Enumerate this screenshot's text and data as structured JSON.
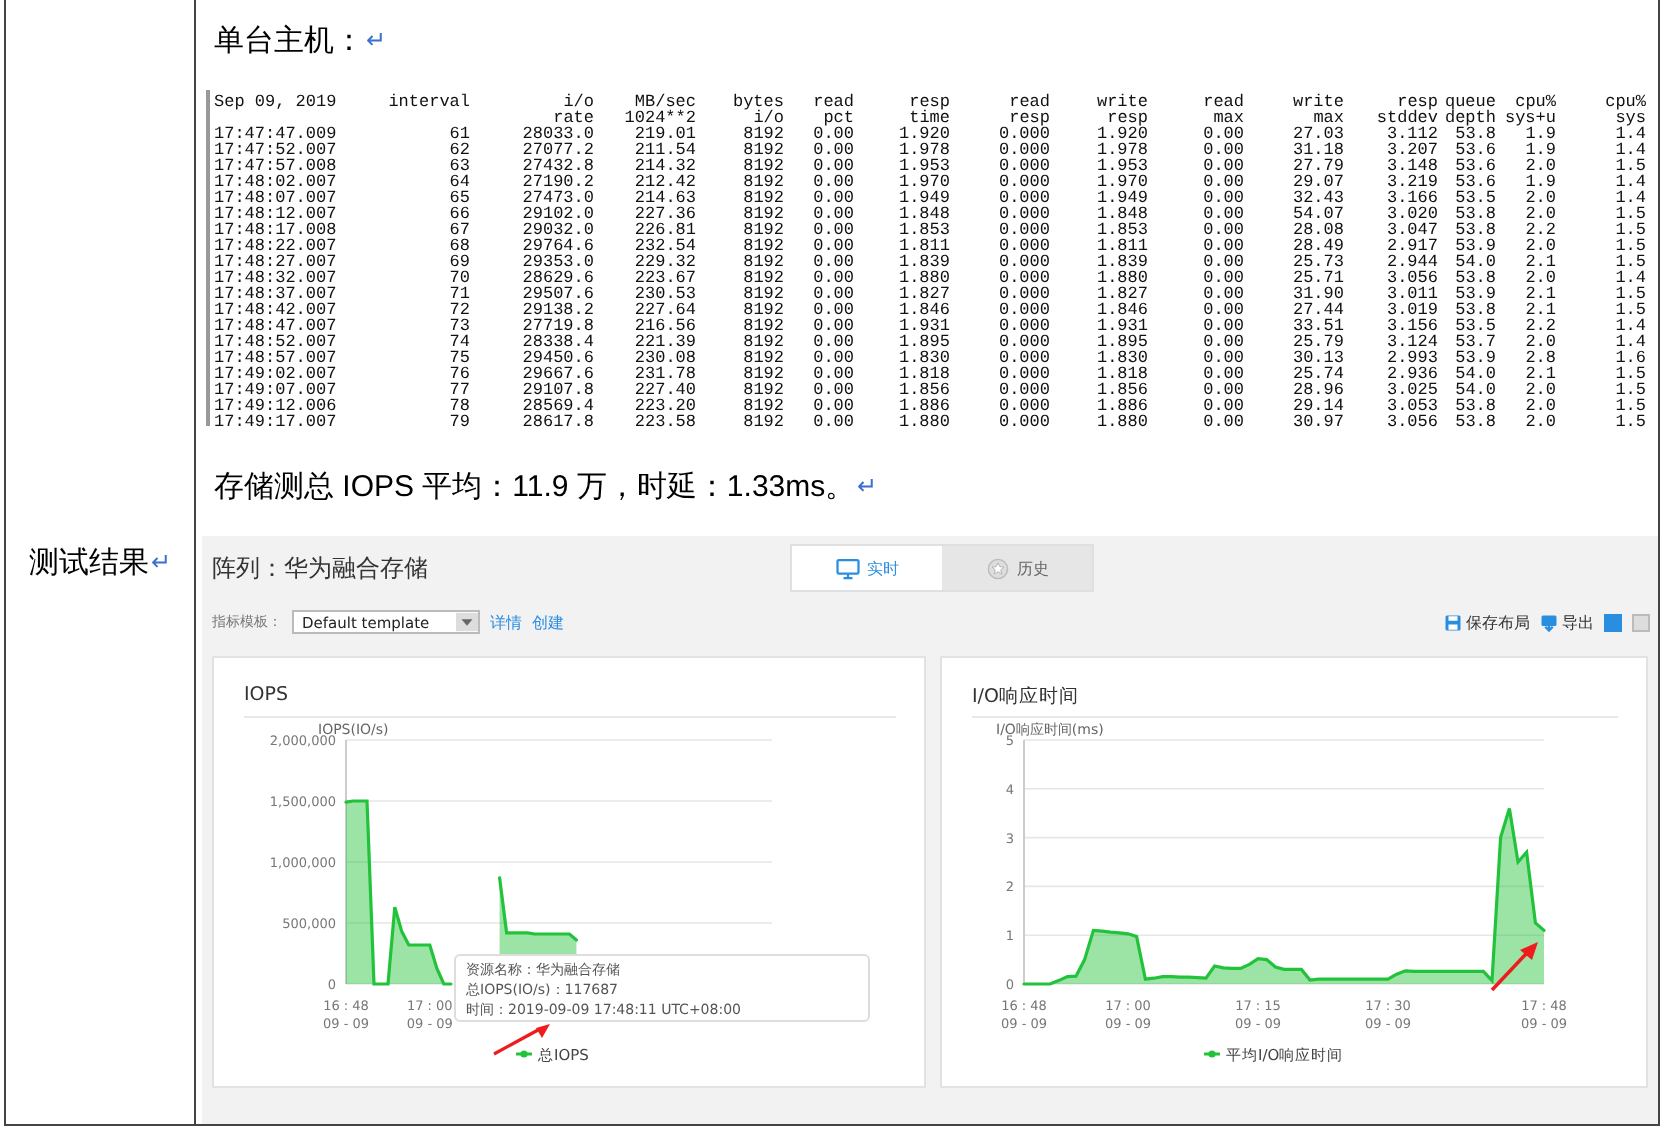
{
  "table": {
    "label_cell": {
      "text": "测试结果",
      "mark": "↵"
    },
    "content": {
      "heading": {
        "text": "单台主机：",
        "mark": "↵"
      },
      "terminal": {
        "columns": [
          {
            "lines": [
              "Sep 09, 2019"
            ]
          },
          {
            "lines": [
              "interval"
            ]
          },
          {
            "lines": [
              "i/o",
              "rate"
            ]
          },
          {
            "lines": [
              "MB/sec",
              "1024**2"
            ]
          },
          {
            "lines": [
              "bytes",
              "i/o"
            ]
          },
          {
            "lines": [
              "read",
              "pct"
            ]
          },
          {
            "lines": [
              "resp",
              "time"
            ]
          },
          {
            "lines": [
              "read",
              "resp"
            ]
          },
          {
            "lines": [
              "write",
              "resp"
            ]
          },
          {
            "lines": [
              "read",
              "max"
            ]
          },
          {
            "lines": [
              "write",
              "max"
            ]
          },
          {
            "lines": [
              "resp",
              "stddev"
            ]
          },
          {
            "lines": [
              "queue",
              "depth"
            ]
          },
          {
            "lines": [
              "cpu%",
              "sys+u"
            ]
          },
          {
            "lines": [
              "cpu%",
              "sys"
            ]
          }
        ],
        "rows": [
          [
            "17:47:47.009",
            "61",
            "28033.0",
            "219.01",
            "8192",
            "0.00",
            "1.920",
            "0.000",
            "1.920",
            "0.00",
            "27.03",
            "3.112",
            "53.8",
            "1.9",
            "1.4"
          ],
          [
            "17:47:52.007",
            "62",
            "27077.2",
            "211.54",
            "8192",
            "0.00",
            "1.978",
            "0.000",
            "1.978",
            "0.00",
            "31.18",
            "3.207",
            "53.6",
            "1.9",
            "1.4"
          ],
          [
            "17:47:57.008",
            "63",
            "27432.8",
            "214.32",
            "8192",
            "0.00",
            "1.953",
            "0.000",
            "1.953",
            "0.00",
            "27.79",
            "3.148",
            "53.6",
            "2.0",
            "1.5"
          ],
          [
            "17:48:02.007",
            "64",
            "27190.2",
            "212.42",
            "8192",
            "0.00",
            "1.970",
            "0.000",
            "1.970",
            "0.00",
            "29.07",
            "3.219",
            "53.6",
            "1.9",
            "1.4"
          ],
          [
            "17:48:07.007",
            "65",
            "27473.0",
            "214.63",
            "8192",
            "0.00",
            "1.949",
            "0.000",
            "1.949",
            "0.00",
            "32.43",
            "3.166",
            "53.5",
            "2.0",
            "1.4"
          ],
          [
            "17:48:12.007",
            "66",
            "29102.0",
            "227.36",
            "8192",
            "0.00",
            "1.848",
            "0.000",
            "1.848",
            "0.00",
            "54.07",
            "3.020",
            "53.8",
            "2.0",
            "1.5"
          ],
          [
            "17:48:17.008",
            "67",
            "29032.0",
            "226.81",
            "8192",
            "0.00",
            "1.853",
            "0.000",
            "1.853",
            "0.00",
            "28.08",
            "3.047",
            "53.8",
            "2.2",
            "1.5"
          ],
          [
            "17:48:22.007",
            "68",
            "29764.6",
            "232.54",
            "8192",
            "0.00",
            "1.811",
            "0.000",
            "1.811",
            "0.00",
            "28.49",
            "2.917",
            "53.9",
            "2.0",
            "1.5"
          ],
          [
            "17:48:27.007",
            "69",
            "29353.0",
            "229.32",
            "8192",
            "0.00",
            "1.839",
            "0.000",
            "1.839",
            "0.00",
            "25.73",
            "2.944",
            "54.0",
            "2.1",
            "1.5"
          ],
          [
            "17:48:32.007",
            "70",
            "28629.6",
            "223.67",
            "8192",
            "0.00",
            "1.880",
            "0.000",
            "1.880",
            "0.00",
            "25.71",
            "3.056",
            "53.8",
            "2.0",
            "1.4"
          ],
          [
            "17:48:37.007",
            "71",
            "29507.6",
            "230.53",
            "8192",
            "0.00",
            "1.827",
            "0.000",
            "1.827",
            "0.00",
            "31.90",
            "3.011",
            "53.9",
            "2.1",
            "1.5"
          ],
          [
            "17:48:42.007",
            "72",
            "29138.2",
            "227.64",
            "8192",
            "0.00",
            "1.846",
            "0.000",
            "1.846",
            "0.00",
            "27.44",
            "3.019",
            "53.8",
            "2.1",
            "1.5"
          ],
          [
            "17:48:47.007",
            "73",
            "27719.8",
            "216.56",
            "8192",
            "0.00",
            "1.931",
            "0.000",
            "1.931",
            "0.00",
            "33.51",
            "3.156",
            "53.5",
            "2.2",
            "1.4"
          ],
          [
            "17:48:52.007",
            "74",
            "28338.4",
            "221.39",
            "8192",
            "0.00",
            "1.895",
            "0.000",
            "1.895",
            "0.00",
            "25.79",
            "3.124",
            "53.7",
            "2.0",
            "1.4"
          ],
          [
            "17:48:57.007",
            "75",
            "29450.6",
            "230.08",
            "8192",
            "0.00",
            "1.830",
            "0.000",
            "1.830",
            "0.00",
            "30.13",
            "2.993",
            "53.9",
            "2.8",
            "1.6"
          ],
          [
            "17:49:02.007",
            "76",
            "29667.6",
            "231.78",
            "8192",
            "0.00",
            "1.818",
            "0.000",
            "1.818",
            "0.00",
            "25.74",
            "2.936",
            "54.0",
            "2.1",
            "1.5"
          ],
          [
            "17:49:07.007",
            "77",
            "29107.8",
            "227.40",
            "8192",
            "0.00",
            "1.856",
            "0.000",
            "1.856",
            "0.00",
            "28.96",
            "3.025",
            "54.0",
            "2.0",
            "1.5"
          ],
          [
            "17:49:12.006",
            "78",
            "28569.4",
            "223.20",
            "8192",
            "0.00",
            "1.886",
            "0.000",
            "1.886",
            "0.00",
            "29.14",
            "3.053",
            "53.8",
            "2.0",
            "1.5"
          ],
          [
            "17:49:17.007",
            "79",
            "28617.8",
            "223.58",
            "8192",
            "0.00",
            "1.880",
            "0.000",
            "1.880",
            "0.00",
            "30.97",
            "3.056",
            "53.8",
            "2.0",
            "1.5"
          ]
        ]
      },
      "summary": {
        "text": "存储测总 IOPS 平均：11.9 万，时延：1.33ms。",
        "mark": "↵"
      },
      "screenshot": {
        "title": "阵列：华为融合存储",
        "tabs": [
          {
            "kind": "monitor",
            "label": "实时",
            "selected": true
          },
          {
            "kind": "history",
            "label": "历史",
            "selected": false
          }
        ],
        "template_label": "指标模板：",
        "template_select": {
          "value": "Default template"
        },
        "links": [
          "详情",
          "创建"
        ],
        "actions": [
          {
            "kind": "save",
            "label": "保存布局"
          },
          {
            "kind": "export",
            "label": "导出"
          }
        ],
        "layout_toggles": [
          {
            "selected": true
          },
          {
            "selected": false
          }
        ],
        "charts": [
          {
            "tooltip": [
              "资源名称：华为融合存储",
              "总IOPS(IO/s)：117687",
              "时间：2019-09-09 17:48:11 UTC+08:00"
            ],
            "chart_data": {
              "type": "area",
              "title": "IOPS",
              "ylabel": "IOPS(IO/s)",
              "categories": [
                "16 : 48\n09 - 09",
                null,
                null,
                null,
                null,
                null,
                null,
                null,
                null,
                null,
                null,
                null,
                "17 : 00\n09 - 09",
                null,
                null,
                null,
                null,
                null,
                null,
                null,
                null,
                null,
                null,
                null,
                null,
                null,
                null,
                null,
                null,
                null,
                null,
                null,
                null,
                null,
                null,
                null,
                null,
                null,
                null,
                null,
                null,
                null,
                null,
                null,
                null,
                null,
                null,
                null,
                null,
                null,
                null,
                null,
                null,
                null,
                null,
                null,
                null,
                null,
                null,
                null,
                null,
                null
              ],
              "series": [
                {
                  "name": "总IOPS",
                  "color": "#22c33a",
                  "values": [
                    1490000,
                    1500000,
                    1500000,
                    1500000,
                    0,
                    0,
                    0,
                    630000,
                    430000,
                    320000,
                    320000,
                    320000,
                    320000,
                    130000,
                    0,
                    0,
                    null,
                    null,
                    null,
                    null,
                    null,
                    null,
                    870000,
                    420000,
                    420000,
                    420000,
                    420000,
                    410000,
                    410000,
                    410000,
                    410000,
                    410000,
                    410000,
                    360000,
                    null,
                    null,
                    null,
                    null,
                    null,
                    null,
                    null,
                    null,
                    null,
                    null,
                    null,
                    null,
                    null,
                    null,
                    null,
                    null,
                    null,
                    null,
                    null,
                    null,
                    null,
                    null,
                    null,
                    null,
                    null,
                    null,
                    null,
                    null
                  ]
                }
              ],
              "ylim": [
                0,
                2000000
              ],
              "grid": true,
              "yticks": [
                {
                  "value": 0,
                  "label": "0"
                },
                {
                  "value": 500000,
                  "label": "500,000"
                },
                {
                  "value": 1000000,
                  "label": "1,000,000"
                },
                {
                  "value": 1500000,
                  "label": "1,500,000"
                },
                {
                  "value": 2000000,
                  "label": "2,000,000"
                }
              ]
            }
          },
          {
            "chart_data": {
              "type": "area",
              "title": "I/O响应时间",
              "ylabel": "I/O响应时间(ms)",
              "categories": [
                "16 : 48\n09 - 09",
                null,
                null,
                null,
                null,
                null,
                null,
                null,
                null,
                null,
                null,
                null,
                "17 : 00\n09 - 09",
                null,
                null,
                null,
                null,
                null,
                null,
                null,
                null,
                null,
                null,
                null,
                null,
                null,
                null,
                "17 : 15\n09 - 09",
                null,
                null,
                null,
                null,
                null,
                null,
                null,
                null,
                null,
                null,
                null,
                null,
                null,
                null,
                "17 : 30\n09 - 09",
                null,
                null,
                null,
                null,
                null,
                null,
                null,
                null,
                null,
                null,
                null,
                null,
                null,
                null,
                null,
                null,
                null,
                "17 : 48\n09 - 09"
              ],
              "series": [
                {
                  "name": "平均I/O响应时间",
                  "color": "#22c33a",
                  "values": [
                    0,
                    0,
                    0,
                    0,
                    0.07,
                    0.15,
                    0.16,
                    0.5,
                    1.1,
                    1.08,
                    1.06,
                    1.05,
                    1.03,
                    0.97,
                    0.1,
                    0.12,
                    0.15,
                    0.15,
                    0.14,
                    0.14,
                    0.13,
                    0.12,
                    0.37,
                    0.33,
                    0.32,
                    0.32,
                    0.4,
                    0.52,
                    0.5,
                    0.35,
                    0.3,
                    0.3,
                    0.3,
                    0.08,
                    0.1,
                    0.1,
                    0.1,
                    0.1,
                    0.1,
                    0.1,
                    0.1,
                    0.1,
                    0.1,
                    0.2,
                    0.27,
                    0.26,
                    0.26,
                    0.26,
                    0.26,
                    0.26,
                    0.26,
                    0.26,
                    0.26,
                    0.26,
                    0.07,
                    3.0,
                    3.6,
                    2.5,
                    2.7,
                    1.25,
                    1.1
                  ]
                }
              ],
              "ylim": [
                0,
                5
              ],
              "grid": true,
              "yticks": [
                0,
                1,
                2,
                3,
                4,
                5
              ]
            }
          }
        ]
      }
    }
  }
}
